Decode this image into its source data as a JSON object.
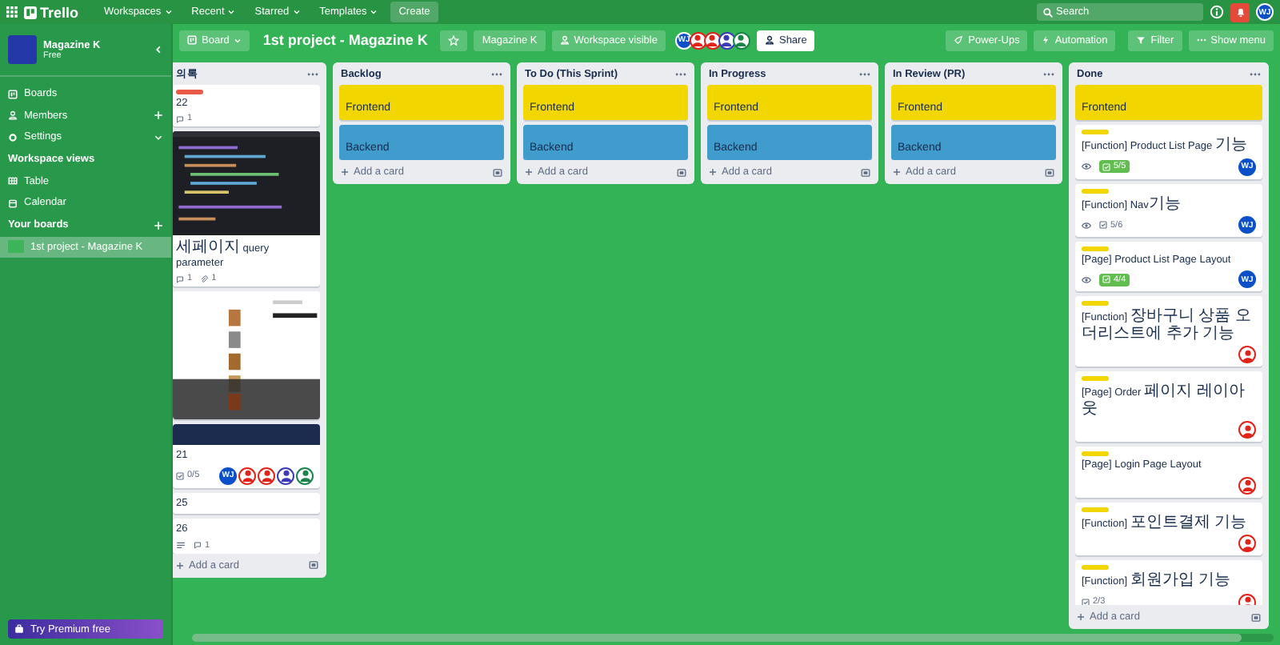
{
  "topbar": {
    "logo": "Trello",
    "menus": [
      {
        "label": "Workspaces"
      },
      {
        "label": "Recent"
      },
      {
        "label": "Starred"
      },
      {
        "label": "Templates"
      }
    ],
    "create": "Create",
    "search": {
      "placeholder": "Search"
    },
    "avatar": "WJ"
  },
  "sidebar": {
    "workspace": {
      "name": "Magazine K",
      "plan": "Free"
    },
    "items": [
      {
        "label": "Boards"
      },
      {
        "label": "Members"
      },
      {
        "label": "Settings"
      }
    ],
    "views_heading": "Workspace views",
    "views": [
      {
        "label": "Table"
      },
      {
        "label": "Calendar"
      }
    ],
    "boards_heading": "Your boards",
    "boards": [
      {
        "label": "1st project - Magazine K",
        "selected": true
      }
    ],
    "premium": "Try Premium free"
  },
  "board": {
    "view": "Board",
    "title": "1st project - Magazine K",
    "starred": false,
    "workspace": "Magazine K",
    "visibility": "Workspace visible",
    "members": [
      {
        "kind": "initials",
        "text": "WJ",
        "color": "#0b50c8"
      },
      {
        "kind": "person",
        "color": "#e2231a"
      },
      {
        "kind": "person",
        "color": "#e2231a"
      },
      {
        "kind": "person",
        "color": "#3b3ab8"
      },
      {
        "kind": "person",
        "color": "#19844a"
      }
    ],
    "share": "Share",
    "power_ups": "Power-Ups",
    "automation": "Automation",
    "filter": "Filter",
    "show_menu": "Show menu"
  },
  "lists": [
    {
      "title": "의록",
      "add": "Add a card",
      "cards": [
        {
          "kind": "card",
          "label": {
            "color": "#eb5a46"
          },
          "title": "22",
          "badges": [
            {
              "kind": "comments",
              "text": "1"
            }
          ]
        },
        {
          "kind": "picture",
          "title": "세페이지 query parameter",
          "badges": [
            {
              "kind": "comments",
              "text": "1"
            },
            {
              "kind": "attachments",
              "text": "1"
            }
          ]
        },
        {
          "kind": "picture"
        },
        {
          "kind": "card",
          "cover": {
            "color": "#1b2c4f"
          },
          "title": "21",
          "badges": [
            {
              "kind": "checklist",
              "text": "0/5",
              "complete": false
            }
          ],
          "members": [
            {
              "kind": "initials",
              "text": "WJ",
              "color": "#0b50c8"
            },
            {
              "kind": "person",
              "color": "#e2231a"
            },
            {
              "kind": "person",
              "color": "#e2231a"
            },
            {
              "kind": "person",
              "color": "#3b3ab8"
            },
            {
              "kind": "person",
              "color": "#19844a"
            }
          ]
        },
        {
          "kind": "card",
          "title": "25"
        },
        {
          "kind": "card",
          "title": "26",
          "badges": [
            {
              "kind": "description"
            },
            {
              "kind": "comments",
              "text": "1"
            }
          ]
        }
      ]
    },
    {
      "title": "Backlog",
      "add": "Add a card",
      "cards": [
        {
          "kind": "color",
          "color": "#f2d600",
          "title": "Frontend"
        },
        {
          "kind": "color",
          "color": "#3f9ccc",
          "title": "Backend"
        }
      ]
    },
    {
      "title": "To Do (This Sprint)",
      "add": "Add a card",
      "cards": [
        {
          "kind": "color",
          "color": "#f2d600",
          "title": "Frontend"
        },
        {
          "kind": "color",
          "color": "#3f9ccc",
          "title": "Backend"
        }
      ]
    },
    {
      "title": "In Progress",
      "add": "Add a card",
      "cards": [
        {
          "kind": "color",
          "color": "#f2d600",
          "title": "Frontend"
        },
        {
          "kind": "color",
          "color": "#3f9ccc",
          "title": "Backend"
        }
      ]
    },
    {
      "title": "In Review (PR)",
      "add": "Add a card",
      "cards": [
        {
          "kind": "color",
          "color": "#f2d600",
          "title": "Frontend"
        },
        {
          "kind": "color",
          "color": "#3f9ccc",
          "title": "Backend"
        }
      ]
    },
    {
      "title": "Done",
      "add": "Add a card",
      "cards": [
        {
          "kind": "color",
          "color": "#f2d600",
          "title": "Frontend"
        },
        {
          "kind": "card",
          "label": {
            "color": "#f2d600"
          },
          "title": "[Function] Product List Page 기능",
          "badges": [
            {
              "kind": "watch"
            },
            {
              "kind": "checklist",
              "text": "5/5",
              "complete": true
            }
          ],
          "members": [
            {
              "kind": "initials",
              "text": "WJ",
              "color": "#0b50c8"
            }
          ]
        },
        {
          "kind": "card",
          "label": {
            "color": "#f2d600"
          },
          "title": "[Function] Nav기능",
          "badges": [
            {
              "kind": "watch"
            },
            {
              "kind": "checklist",
              "text": "5/6",
              "complete": false
            }
          ],
          "members": [
            {
              "kind": "initials",
              "text": "WJ",
              "color": "#0b50c8"
            }
          ]
        },
        {
          "kind": "card",
          "label": {
            "color": "#f2d600"
          },
          "title": "[Page] Product List Page Layout",
          "badges": [
            {
              "kind": "watch"
            },
            {
              "kind": "checklist",
              "text": "4/4",
              "complete": true
            }
          ],
          "members": [
            {
              "kind": "initials",
              "text": "WJ",
              "color": "#0b50c8"
            }
          ]
        },
        {
          "kind": "card",
          "label": {
            "color": "#f2d600"
          },
          "title": "[Function] 장바구니 상품 오더리스트에 추가 기능",
          "members": [
            {
              "kind": "person",
              "color": "#e2231a"
            }
          ]
        },
        {
          "kind": "card",
          "label": {
            "color": "#f2d600"
          },
          "title": "[Page] Order 페이지 레이아웃",
          "members": [
            {
              "kind": "person",
              "color": "#e2231a"
            }
          ]
        },
        {
          "kind": "card",
          "label": {
            "color": "#f2d600"
          },
          "title": "[Page] Login Page Layout",
          "members": [
            {
              "kind": "person",
              "color": "#e2231a"
            }
          ]
        },
        {
          "kind": "card",
          "label": {
            "color": "#f2d600"
          },
          "title": "[Function] 포인트결제 기능",
          "members": [
            {
              "kind": "person",
              "color": "#e2231a"
            }
          ]
        },
        {
          "kind": "card",
          "label": {
            "color": "#f2d600"
          },
          "title": "[Function] 회원가입 기능",
          "badges": [
            {
              "kind": "checklist",
              "text": "2/3",
              "complete": false
            }
          ],
          "members": [
            {
              "kind": "person",
              "color": "#e2231a"
            }
          ]
        }
      ]
    }
  ]
}
